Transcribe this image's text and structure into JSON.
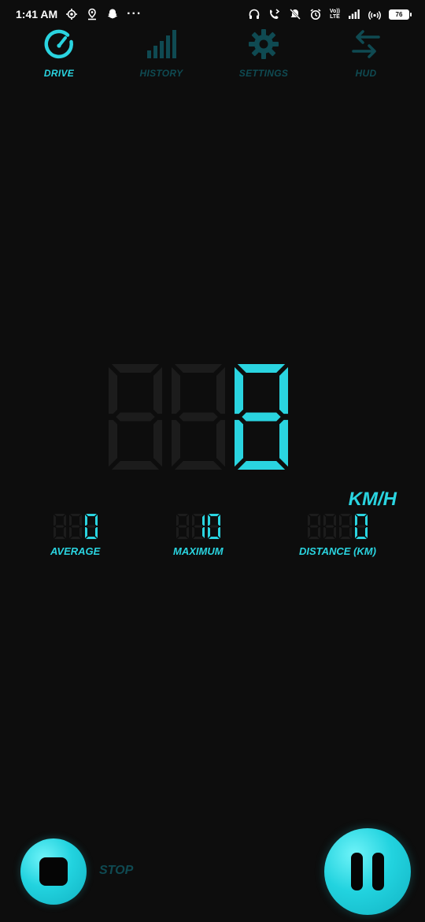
{
  "status_bar": {
    "time": "1:41 AM",
    "left_icons": [
      "location-target-icon",
      "map-pin-icon",
      "snapchat-icon"
    ],
    "more": "···",
    "right_icons": [
      "headset-icon",
      "call-forward-icon",
      "notifications-off-icon",
      "alarm-icon",
      "volte-icon",
      "signal-icon",
      "hotspot-icon"
    ],
    "volte_top": "Vo))",
    "volte_bottom": "LTE",
    "battery": "76"
  },
  "nav": {
    "tabs": [
      {
        "label": "DRIVE",
        "icon": "speedometer-icon",
        "active": true
      },
      {
        "label": "HISTORY",
        "icon": "bar-chart-icon",
        "active": false
      },
      {
        "label": "SETTINGS",
        "icon": "gear-icon",
        "active": false
      },
      {
        "label": "HUD",
        "icon": "swap-arrows-icon",
        "active": false
      }
    ]
  },
  "speed": {
    "value": "008",
    "unit": "KM/H"
  },
  "stats": {
    "average": {
      "value": "000",
      "label": "AVERAGE"
    },
    "maximum": {
      "value": "010",
      "label": "MAXIMUM"
    },
    "distance": {
      "value": "0000",
      "label": "DISTANCE (KM)"
    }
  },
  "controls": {
    "stop_label": "STOP"
  },
  "colors": {
    "accent": "#2ad4e0",
    "dim_accent": "#0f4a52",
    "background": "#0d0d0d",
    "unlit_segment": "#1c1c1c"
  }
}
